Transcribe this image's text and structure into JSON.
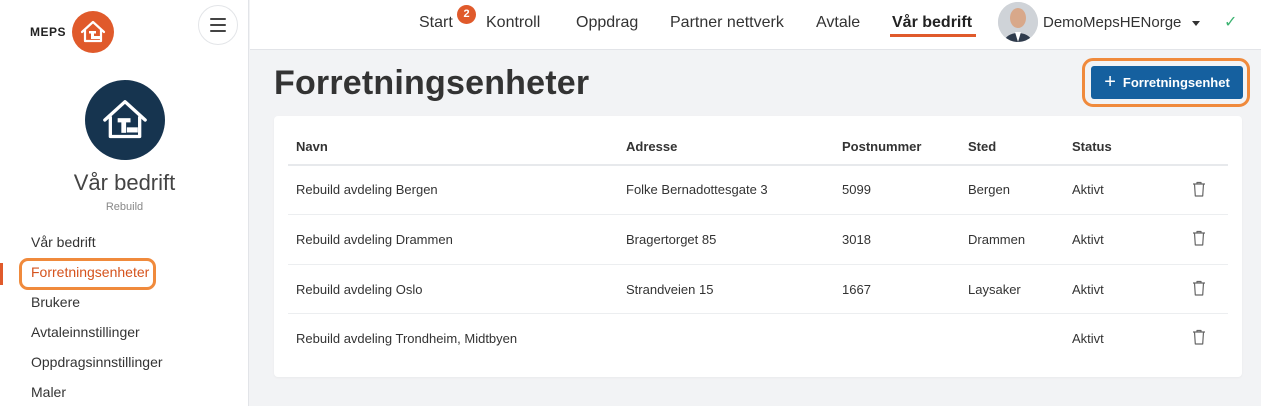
{
  "brand": {
    "name": "MEPS",
    "logo_icon": "house-tools-icon",
    "accent": "#e05a2b"
  },
  "sidebar": {
    "company_name": "Vår bedrift",
    "company_sub": "Rebuild",
    "items": [
      {
        "label": "Vår bedrift"
      },
      {
        "label": "Forretningsenheter",
        "active": true
      },
      {
        "label": "Brukere"
      },
      {
        "label": "Avtaleinnstillinger"
      },
      {
        "label": "Oppdragsinnstillinger"
      },
      {
        "label": "Maler"
      }
    ]
  },
  "topnav": {
    "items": [
      {
        "label": "Start",
        "badge": "2"
      },
      {
        "label": "Kontroll"
      },
      {
        "label": "Oppdrag"
      },
      {
        "label": "Partner nettverk"
      },
      {
        "label": "Avtale"
      },
      {
        "label": "Vår bedrift",
        "active": true
      }
    ],
    "user": "DemoMepsHENorge"
  },
  "page": {
    "title": "Forretningsenheter",
    "add_button": "Forretningsenhet"
  },
  "table": {
    "columns": [
      "Navn",
      "Adresse",
      "Postnummer",
      "Sted",
      "Status"
    ],
    "rows": [
      {
        "navn": "Rebuild avdeling Bergen",
        "adresse": "Folke Bernadottesgate 3",
        "postnummer": "5099",
        "sted": "Bergen",
        "status": "Aktivt"
      },
      {
        "navn": "Rebuild avdeling Drammen",
        "adresse": "Bragertorget 85",
        "postnummer": "3018",
        "sted": "Drammen",
        "status": "Aktivt"
      },
      {
        "navn": "Rebuild avdeling Oslo",
        "adresse": "Strandveien 15",
        "postnummer": "1667",
        "sted": "Laysaker",
        "status": "Aktivt"
      },
      {
        "navn": "Rebuild avdeling Trondheim, Midtbyen",
        "adresse": "",
        "postnummer": "",
        "sted": "",
        "status": "Aktivt"
      }
    ]
  },
  "colors": {
    "primary_button": "#15609f",
    "highlight_ring": "#f08a3c",
    "sidebar_logo_bg": "#16344f"
  }
}
